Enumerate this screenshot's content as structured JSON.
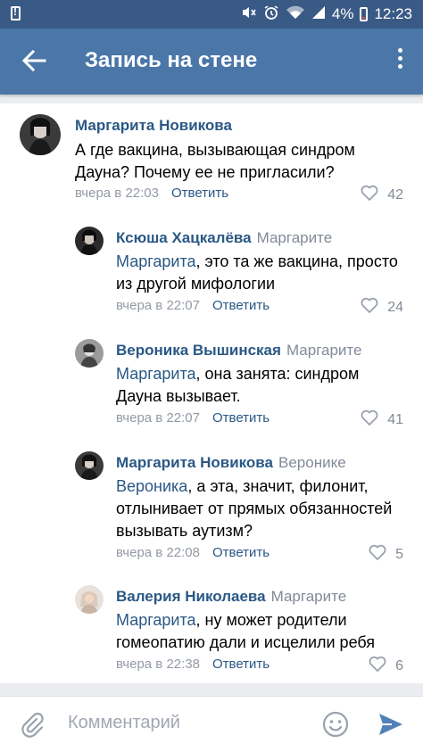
{
  "status_bar": {
    "battery_pct": "4%",
    "time": "12:23",
    "icons": [
      "notification-icon",
      "mute-icon",
      "alarm-icon",
      "wifi-icon",
      "signal-icon",
      "battery-icon"
    ]
  },
  "header": {
    "title": "Запись на стене"
  },
  "comments": [
    {
      "author": "Маргарита Новикова",
      "reply_to": "",
      "mention": "",
      "text": "А где вакцина, вызывающая синдром Дауна? Почему ее не пригласили?",
      "time": "вчера в 22:03",
      "reply_label": "Ответить",
      "likes": "42"
    },
    {
      "author": "Ксюша Хацкалёва",
      "reply_to": "Маргарите",
      "mention": "Маргарита",
      "text": ", это та же вакцина, просто из другой мифологии",
      "time": "вчера в 22:07",
      "reply_label": "Ответить",
      "likes": "24"
    },
    {
      "author": "Вероника Вышинская",
      "reply_to": "Маргарите",
      "mention": "Маргарита",
      "text": ", она занята: синдром Дауна вызывает.",
      "time": "вчера в 22:07",
      "reply_label": "Ответить",
      "likes": "41"
    },
    {
      "author": "Маргарита Новикова",
      "reply_to": "Веронике",
      "mention": "Вероника",
      "text": ", а эта, значит, филонит, отлынивает от прямых обязанностей вызывать аутизм?",
      "time": "вчера в 22:08",
      "reply_label": "Ответить",
      "likes": "5"
    },
    {
      "author": "Валерия Николаева",
      "reply_to": "Маргарите",
      "mention": "Маргарита",
      "text": ", ну может родители гомеопатию дали и исцелили ребя",
      "time": "вчера в 22:38",
      "reply_label": "Ответить",
      "likes": "6"
    }
  ],
  "composer": {
    "placeholder": "Комментарий"
  },
  "colors": {
    "status_bar": "#3a5a86",
    "app_bar": "#4a76a8",
    "link": "#2a5885",
    "meta": "#939aa6",
    "send": "#5181b8"
  }
}
